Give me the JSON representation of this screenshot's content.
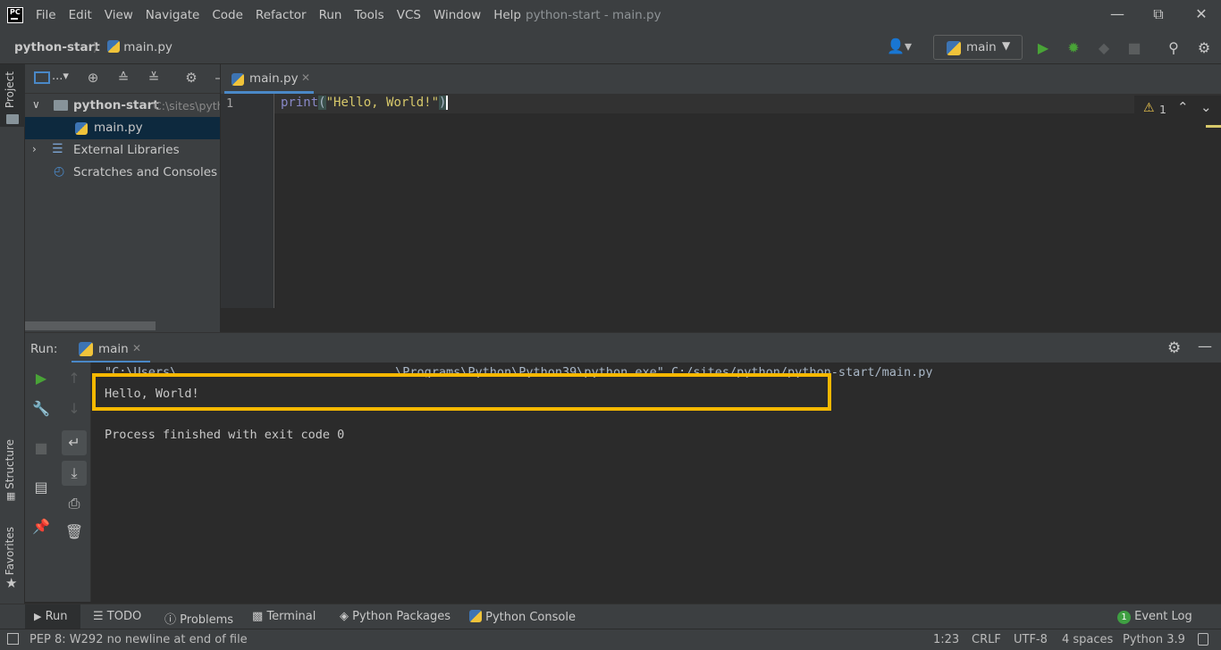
{
  "window": {
    "title": "python-start - main.py",
    "menu": [
      "File",
      "Edit",
      "View",
      "Navigate",
      "Code",
      "Refactor",
      "Run",
      "Tools",
      "VCS",
      "Window",
      "Help"
    ],
    "logo": "PC"
  },
  "navbar": {
    "project": "python-start",
    "file": "main.py",
    "run_config": "main"
  },
  "left_stripe": {
    "project": "Project",
    "structure": "Structure",
    "favorites": "Favorites"
  },
  "project_tree": {
    "toolbar_more": "...",
    "root_name": "python-start",
    "root_path": "C:\\sites\\pyth",
    "items": [
      "main.py",
      "External Libraries",
      "Scratches and Consoles"
    ]
  },
  "editor": {
    "tab": "main.py",
    "line_number": "1",
    "code": {
      "func": "print",
      "open": "(",
      "string": "\"Hello, World!\"",
      "close": ")"
    },
    "warning_count": "1"
  },
  "run_panel": {
    "label": "Run:",
    "tab": "main",
    "command_line": "\"C:\\Users\\                              \\Programs\\Python\\Python39\\python.exe\" C:/sites/python/python-start/main.py",
    "output": "Hello, World!",
    "exit_message": "Process finished with exit code 0",
    "highlight_color": "#f5b800"
  },
  "bottom_tabs": [
    "Run",
    "TODO",
    "Problems",
    "Terminal",
    "Python Packages",
    "Python Console"
  ],
  "event_log": {
    "count": "1",
    "label": "Event Log"
  },
  "status": {
    "message": "PEP 8: W292 no newline at end of file",
    "position": "1:23",
    "line_sep": "CRLF",
    "encoding": "UTF-8",
    "indent": "4 spaces",
    "interpreter": "Python 3.9"
  }
}
